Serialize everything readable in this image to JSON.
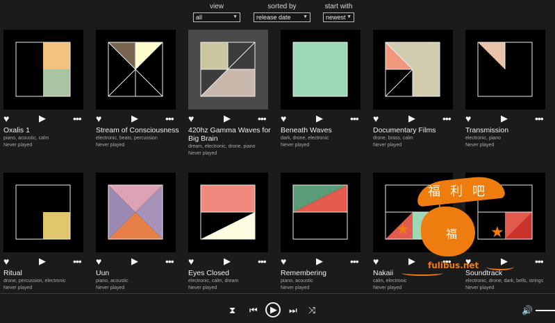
{
  "filters": {
    "view": {
      "label": "view",
      "value": "all"
    },
    "sorted_by": {
      "label": "sorted by",
      "value": "release date"
    },
    "start_with": {
      "label": "start with",
      "value": "newest"
    }
  },
  "albums": [
    {
      "title": "Oxalis 1",
      "tags": "piano, acoustic, calm",
      "status": "Never played"
    },
    {
      "title": "Stream of Consciousness",
      "tags": "electronic, beats, percussion",
      "status": "Never played"
    },
    {
      "title": "420hz Gamma Waves for Big Brain",
      "tags": "dream, electronic, drone, piano",
      "status": "Never played"
    },
    {
      "title": "Beneath Waves",
      "tags": "dark, drone, electronic",
      "status": "Never played"
    },
    {
      "title": "Documentary Films",
      "tags": "drone, brass, calm",
      "status": "Never played"
    },
    {
      "title": "Transmission",
      "tags": "electronic, piano",
      "status": "Never played"
    },
    {
      "title": "Ritual",
      "tags": "drone, percussion, electronic",
      "status": "Never played"
    },
    {
      "title": "Uun",
      "tags": "piano, acoustic",
      "status": "Never played"
    },
    {
      "title": "Eyes Closed",
      "tags": "electronic, calm, dream",
      "status": "Never played"
    },
    {
      "title": "Remembering",
      "tags": "piano, acoustic",
      "status": "Never played"
    },
    {
      "title": "Nakaii",
      "tags": "calm, electronic",
      "status": "Never played"
    },
    {
      "title": "Soundtrack",
      "tags": "electronic, drone, dark, bells, strings",
      "status": "Never played"
    }
  ],
  "card_icons": {
    "like": "heart-icon",
    "play": "play-icon",
    "more": "more-icon"
  },
  "player": {
    "icons": [
      "hourglass-icon",
      "previous-icon",
      "play-icon",
      "next-icon",
      "shuffle-icon",
      "volume-icon"
    ]
  },
  "watermark": {
    "chars": "福利吧",
    "seal": "福",
    "domain": "fulibus.net"
  },
  "colors": {
    "background": "#1b1b1b",
    "highlight": "#4a4a4a",
    "peach": "#f2c27f",
    "sage": "#a9c3a3",
    "mint": "#9bd8b6",
    "salmon": "#f08a7e",
    "watermark": "#ef7c0f"
  }
}
